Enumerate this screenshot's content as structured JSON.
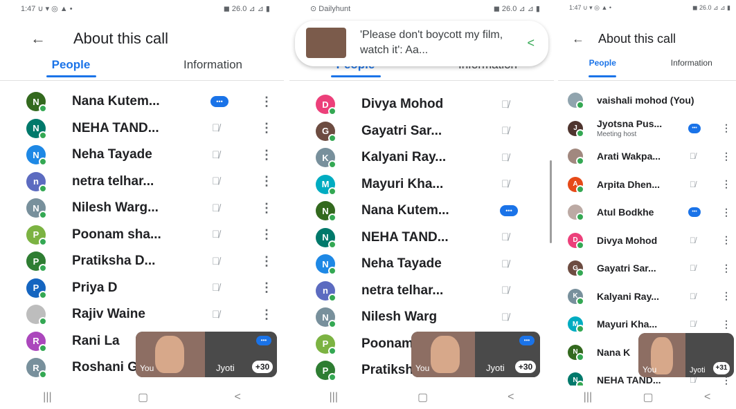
{
  "panel1": {
    "status": {
      "left": "1:47 ∪ ▾ ◎ ▲ •",
      "right": "◼ 26.0 ⊿ ⊿ ▮"
    },
    "header": {
      "back": "←",
      "title": "About this call"
    },
    "tabs": [
      {
        "label": "People"
      },
      {
        "label": "Information"
      }
    ],
    "rows": [
      {
        "initial": "N",
        "name": "Nana Kutem...",
        "color": "#33691e",
        "state": "speaking"
      },
      {
        "initial": "N",
        "name": "NEHA TAND...",
        "color": "#00796b",
        "state": "muted"
      },
      {
        "initial": "N",
        "name": "Neha Tayade",
        "color": "#1e88e5",
        "state": "muted"
      },
      {
        "initial": "n",
        "name": "netra telhar...",
        "color": "#5c6bc0",
        "state": "muted"
      },
      {
        "initial": "N",
        "name": "Nilesh Warg...",
        "color": "#78909c",
        "state": "muted"
      },
      {
        "initial": "P",
        "name": "Poonam sha...",
        "color": "#7cb342",
        "state": "muted"
      },
      {
        "initial": "P",
        "name": "Pratiksha D...",
        "color": "#2e7d32",
        "state": "muted"
      },
      {
        "initial": "P",
        "name": "Priya D",
        "color": "#1565c0",
        "state": "muted"
      },
      {
        "initial": "",
        "name": "Rajiv Waine",
        "color": "#bdbdbd",
        "state": "muted"
      },
      {
        "initial": "R",
        "name": "Rani La",
        "color": "#ab47bc",
        "state": "none"
      },
      {
        "initial": "R",
        "name": "Roshani Gul...",
        "color": "#78909c",
        "state": "muted"
      }
    ],
    "overlay": {
      "you": "You",
      "name": "Jyoti",
      "count": "+30"
    },
    "nav": [
      "|||",
      "▢",
      "<"
    ]
  },
  "panel2": {
    "status": {
      "left": "⊙ Dailyhunt",
      "right": "◼ 26.0 ⊿ ⊿ ▮"
    },
    "notification": {
      "text": "'Please don't boycott my film, watch it': Aa...",
      "share": "<"
    },
    "tabs": [
      {
        "label": "People"
      },
      {
        "label": "Information"
      }
    ],
    "rows": [
      {
        "initial": "D",
        "name": "Divya Mohod",
        "color": "#ec407a",
        "state": "muted"
      },
      {
        "initial": "G",
        "name": "Gayatri Sar...",
        "color": "#6d4c41",
        "state": "muted"
      },
      {
        "initial": "K",
        "name": "Kalyani Ray...",
        "color": "#78909c",
        "state": "muted"
      },
      {
        "initial": "M",
        "name": "Mayuri Kha...",
        "color": "#00acc1",
        "state": "muted"
      },
      {
        "initial": "N",
        "name": "Nana Kutem...",
        "color": "#33691e",
        "state": "speaking"
      },
      {
        "initial": "N",
        "name": "NEHA TAND...",
        "color": "#00796b",
        "state": "muted"
      },
      {
        "initial": "N",
        "name": "Neha Tayade",
        "color": "#1e88e5",
        "state": "muted"
      },
      {
        "initial": "n",
        "name": "netra telhar...",
        "color": "#5c6bc0",
        "state": "muted"
      },
      {
        "initial": "N",
        "name": "Nilesh Warg",
        "color": "#78909c",
        "state": "muted"
      },
      {
        "initial": "P",
        "name": "Poonam",
        "color": "#7cb342",
        "state": "none"
      },
      {
        "initial": "P",
        "name": "Pratiksha D...",
        "color": "#2e7d32",
        "state": "muted"
      }
    ],
    "overlay": {
      "you": "You",
      "name": "Jyoti",
      "count": "+30"
    },
    "nav": [
      "|||",
      "▢",
      "<"
    ]
  },
  "panel3": {
    "status": {
      "left": "1:47 ∪ ▾ ◎ ▲ •",
      "right": "◼ 26.0 ⊿ ⊿ ▮"
    },
    "header": {
      "back": "←",
      "title": "About this call"
    },
    "tabs": [
      {
        "label": "People"
      },
      {
        "label": "Information"
      }
    ],
    "rows": [
      {
        "initial": "",
        "name": "vaishali mohod (You)",
        "sub": "",
        "color": "#90a4ae",
        "state": "none"
      },
      {
        "initial": "J",
        "name": "Jyotsna Pus...",
        "sub": "Meeting host",
        "color": "#4e342e",
        "state": "speaking"
      },
      {
        "initial": "",
        "name": "Arati Wakpa...",
        "sub": "",
        "color": "#a1887f",
        "state": "muted"
      },
      {
        "initial": "A",
        "name": "Arpita Dhen...",
        "sub": "",
        "color": "#e64a19",
        "state": "muted"
      },
      {
        "initial": "",
        "name": "Atul Bodkhe",
        "sub": "",
        "color": "#bcaaa4",
        "state": "speaking"
      },
      {
        "initial": "D",
        "name": "Divya Mohod",
        "sub": "",
        "color": "#ec407a",
        "state": "muted"
      },
      {
        "initial": "G",
        "name": "Gayatri Sar...",
        "sub": "",
        "color": "#6d4c41",
        "state": "muted"
      },
      {
        "initial": "K",
        "name": "Kalyani Ray...",
        "sub": "",
        "color": "#78909c",
        "state": "muted"
      },
      {
        "initial": "M",
        "name": "Mayuri Kha...",
        "sub": "",
        "color": "#00acc1",
        "state": "muted"
      },
      {
        "initial": "N",
        "name": "Nana K",
        "sub": "",
        "color": "#33691e",
        "state": "none"
      },
      {
        "initial": "N",
        "name": "NEHA TAND...",
        "sub": "",
        "color": "#00796b",
        "state": "muted"
      }
    ],
    "overlay": {
      "you": "You",
      "name": "Jyoti",
      "count": "+31"
    },
    "nav": [
      "|||",
      "▢",
      "<"
    ]
  }
}
